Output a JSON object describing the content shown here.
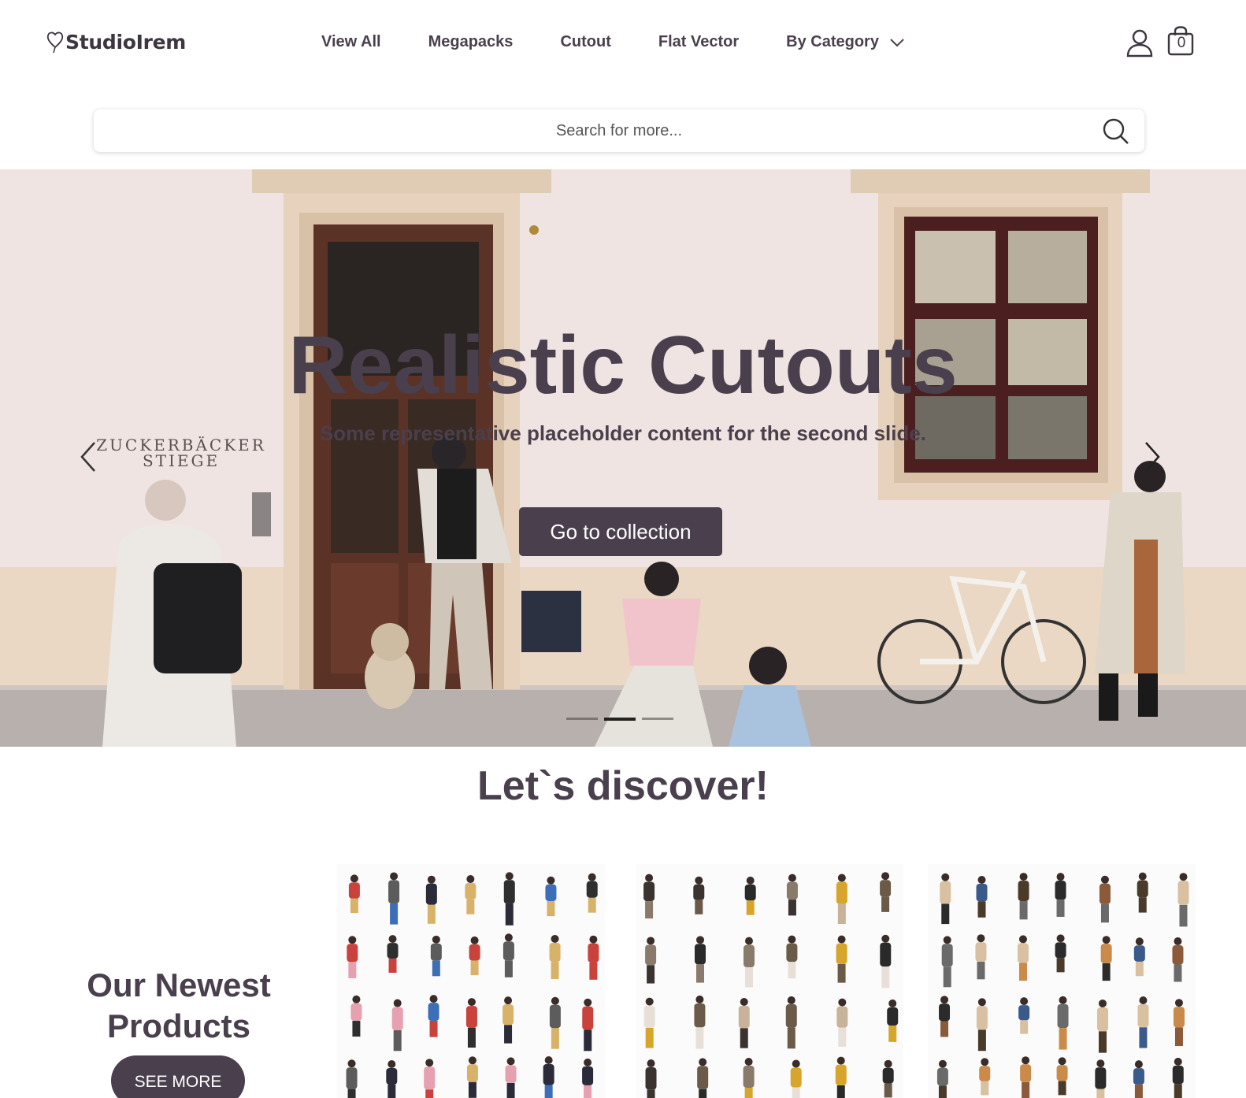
{
  "header": {
    "logo_text": "StudioIrem",
    "nav": [
      {
        "label": "View All"
      },
      {
        "label": "Megapacks"
      },
      {
        "label": "Cutout"
      },
      {
        "label": "Flat Vector"
      },
      {
        "label": "By Category"
      }
    ],
    "cart_count": "0"
  },
  "search": {
    "placeholder": "Search for more..."
  },
  "hero": {
    "title": "Realistic Cutouts",
    "subtitle": "Some representative placeholder content for the second slide.",
    "button_label": "Go to collection",
    "sign_text": "ZUCKERBÄCKER",
    "sign_text2": "STIEGE",
    "active_slide": 2,
    "slide_count": 3
  },
  "discover": {
    "heading": "Let`s discover!"
  },
  "newest": {
    "heading_line1": "Our Newest",
    "heading_line2": "Products",
    "button_label": "SEE MORE"
  },
  "colors": {
    "brand": "#4a3f4d",
    "hero_wall": "#efe4e1",
    "door": "#5a3226"
  }
}
